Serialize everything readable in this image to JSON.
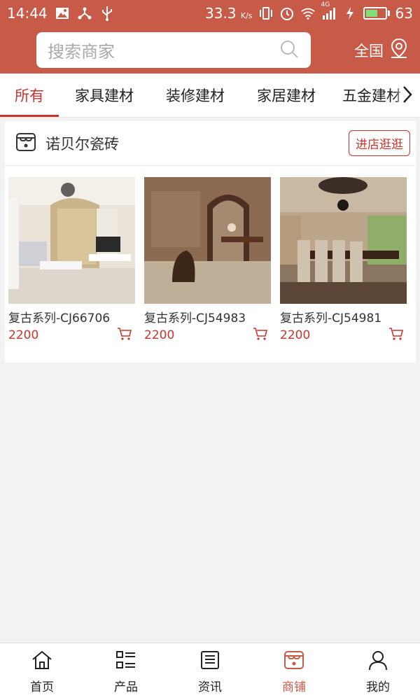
{
  "status_bar": {
    "time": "14:44",
    "network_speed": "33.3",
    "network_unit": "K/s",
    "signal_label": "4G",
    "battery": "63",
    "battery_level": 0.63
  },
  "search": {
    "placeholder": "搜索商家",
    "region": "全国"
  },
  "tabs": [
    {
      "label": "所有",
      "active": true
    },
    {
      "label": "家具建材",
      "active": false
    },
    {
      "label": "装修建材",
      "active": false
    },
    {
      "label": "家居建材",
      "active": false
    },
    {
      "label": "五金建材",
      "active": false
    }
  ],
  "store": {
    "name": "诺贝尔瓷砖",
    "visit_label": "进店逛逛",
    "products": [
      {
        "title": "复古系列-CJ66706",
        "price": "2200"
      },
      {
        "title": "复古系列-CJ54983",
        "price": "2200"
      },
      {
        "title": "复古系列-CJ54981",
        "price": "2200"
      }
    ]
  },
  "bottom_nav": [
    {
      "label": "首页",
      "icon": "home-icon",
      "active": false
    },
    {
      "label": "产品",
      "icon": "grid-list-icon",
      "active": false
    },
    {
      "label": "资讯",
      "icon": "news-icon",
      "active": false
    },
    {
      "label": "商铺",
      "icon": "shop-icon",
      "active": true
    },
    {
      "label": "我的",
      "icon": "user-icon",
      "active": false
    }
  ],
  "colors": {
    "brand": "#c85a48",
    "accent": "#c8352e"
  }
}
